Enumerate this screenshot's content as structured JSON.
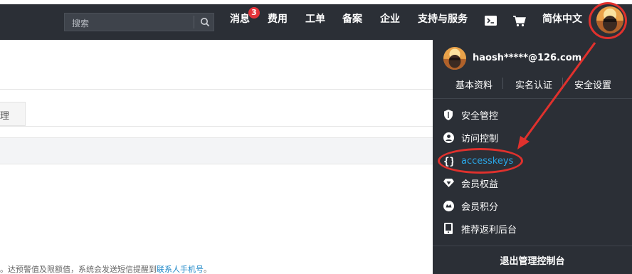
{
  "topbar": {
    "search_placeholder": "搜索",
    "nav": {
      "messages": "消息",
      "messages_badge": "3",
      "fees": "费用",
      "tickets": "工单",
      "filing": "备案",
      "enterprise": "企业",
      "support": "支持与服务",
      "language": "简体中文"
    },
    "icons": [
      "search-icon",
      "terminal-icon",
      "cart-icon",
      "avatar"
    ]
  },
  "page": {
    "tab_fragment": "理",
    "footnote_text": "。达预警值及限额值，系统会发送短信提醒到",
    "footnote_link": "联系人手机号",
    "footnote_end": "。"
  },
  "account_panel": {
    "email": "haosh*****@126.com",
    "links": [
      "基本资料",
      "实名认证",
      "安全设置"
    ],
    "menu": [
      {
        "label": "安全管控",
        "icon": "shield-icon"
      },
      {
        "label": "访问控制",
        "icon": "user-circle-icon"
      },
      {
        "label": "accesskeys",
        "icon": "braces-icon"
      },
      {
        "label": "会员权益",
        "icon": "diamond-icon"
      },
      {
        "label": "会员积分",
        "icon": "points-icon"
      },
      {
        "label": "推荐返利后台",
        "icon": "tablet-icon"
      }
    ],
    "logout": "退出管理控制台"
  },
  "colors": {
    "topbar_bg": "#2b2f36",
    "accent_link": "#2aa7e8",
    "annotation_red": "#e0312d",
    "badge_red": "#e5333a"
  }
}
